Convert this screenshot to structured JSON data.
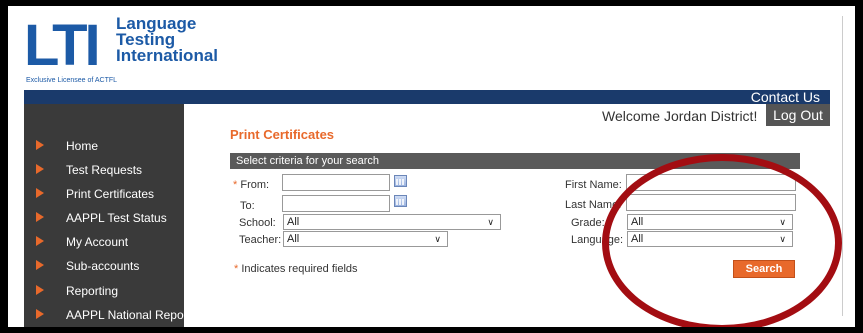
{
  "brand": {
    "mark": "LTI",
    "words": [
      "Language",
      "Testing",
      "International"
    ],
    "sub": "Exclusive Licensee of ACTFL",
    "color": "#1c5aa6"
  },
  "header": {
    "contact": "Contact Us",
    "welcome": "Welcome Jordan District!",
    "logout": "Log Out"
  },
  "sidebar": {
    "items": [
      {
        "label": "Home"
      },
      {
        "label": "Test Requests"
      },
      {
        "label": "Print Certificates"
      },
      {
        "label": "AAPPL Test Status"
      },
      {
        "label": "My Account"
      },
      {
        "label": "Sub-accounts"
      },
      {
        "label": "Reporting"
      },
      {
        "label": "AAPPL National Report"
      }
    ]
  },
  "main": {
    "title": "Print Certificates",
    "criteria": "Select criteria for your search",
    "from_label": "From:",
    "to_label": "To:",
    "school_label": "School:",
    "school_value": "All",
    "teacher_label": "Teacher:",
    "teacher_value": "All",
    "first_name_label": "First Name:",
    "last_name_label": "Last Name:",
    "grade_label": "Grade:",
    "grade_value": "All",
    "language_label": "Language:",
    "language_value": "All",
    "required_star": "*",
    "required_note": "Indicates required fields",
    "search": "Search",
    "from_value": "",
    "to_value": "",
    "first_name_value": "",
    "last_name_value": ""
  },
  "colors": {
    "accent": "#e8692b",
    "navy": "#1a3a6b",
    "sidebar": "#3a3a3a",
    "annotation": "#a30d12"
  }
}
